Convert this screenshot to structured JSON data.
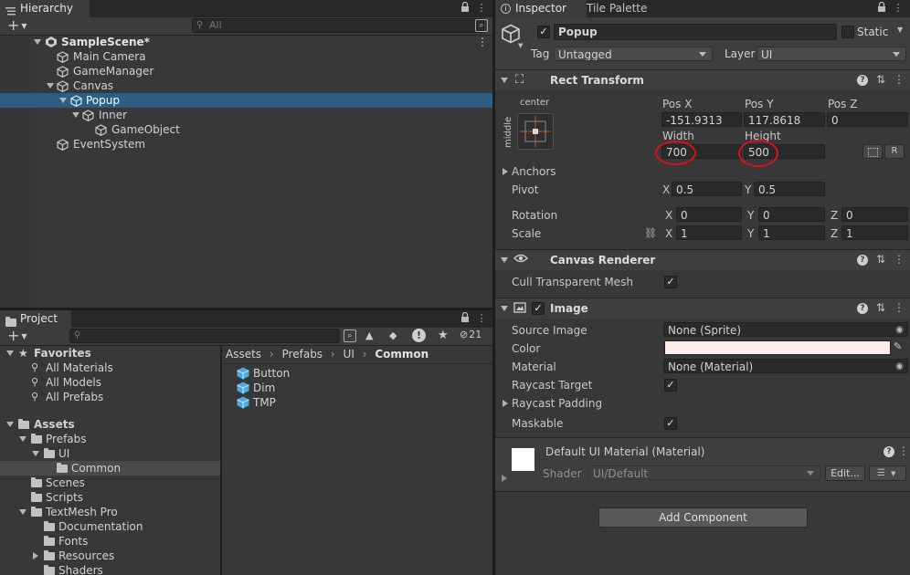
{
  "hierarchy": {
    "tab_label": "Hierarchy",
    "search_placeholder": "All",
    "scene_name": "SampleScene*",
    "items": [
      {
        "label": "Main Camera"
      },
      {
        "label": "GameManager"
      },
      {
        "label": "Canvas"
      },
      {
        "label": "Popup"
      },
      {
        "label": "Inner"
      },
      {
        "label": "GameObject"
      },
      {
        "label": "EventSystem"
      }
    ]
  },
  "project": {
    "tab_label": "Project",
    "hidden_count": "21",
    "favorites": {
      "label": "Favorites",
      "items": [
        "All Materials",
        "All Models",
        "All Prefabs"
      ]
    },
    "tree": {
      "assets": "Assets",
      "prefabs": "Prefabs",
      "ui": "UI",
      "common": "Common",
      "scenes": "Scenes",
      "scripts": "Scripts",
      "textmeshpro": "TextMesh Pro",
      "documentation": "Documentation",
      "fonts": "Fonts",
      "resources": "Resources",
      "shaders": "Shaders"
    },
    "breadcrumb": [
      "Assets",
      "Prefabs",
      "UI",
      "Common"
    ],
    "files": [
      "Button",
      "Dim",
      "TMP"
    ]
  },
  "inspector": {
    "tab_label": "Inspector",
    "tab2_label": "Tile Palette",
    "object_name": "Popup",
    "static_label": "Static",
    "tag_label": "Tag",
    "tag_value": "Untagged",
    "layer_label": "Layer",
    "layer_value": "UI",
    "rect_transform": {
      "title": "Rect Transform",
      "anchor_h": "center",
      "anchor_v": "middle",
      "posx_label": "Pos X",
      "posx": "-151.9313",
      "posy_label": "Pos Y",
      "posy": "117.8618",
      "posz_label": "Pos Z",
      "posz": "0",
      "width_label": "Width",
      "width": "700",
      "height_label": "Height",
      "height": "500",
      "r_button": "R",
      "anchors_label": "Anchors",
      "pivot_label": "Pivot",
      "pivot_x": "0.5",
      "pivot_y": "0.5",
      "rotation_label": "Rotation",
      "rot_x": "0",
      "rot_y": "0",
      "rot_z": "0",
      "scale_label": "Scale",
      "scale_x": "1",
      "scale_y": "1",
      "scale_z": "1",
      "x": "X",
      "y": "Y",
      "z": "Z"
    },
    "canvas_renderer": {
      "title": "Canvas Renderer",
      "cull_label": "Cull Transparent Mesh"
    },
    "image": {
      "title": "Image",
      "source_label": "Source Image",
      "source_value": "None (Sprite)",
      "color_label": "Color",
      "color_value": "#fdeeec",
      "material_label": "Material",
      "material_value": "None (Material)",
      "raycast_target_label": "Raycast Target",
      "raycast_padding_label": "Raycast Padding",
      "maskable_label": "Maskable"
    },
    "material": {
      "name": "Default UI Material (Material)",
      "shader_label": "Shader",
      "shader_value": "UI/Default",
      "edit_button": "Edit..."
    },
    "add_component": "Add Component"
  },
  "colors": {
    "selection": "#2c5d87",
    "highlight_circle": "#d8101a"
  }
}
